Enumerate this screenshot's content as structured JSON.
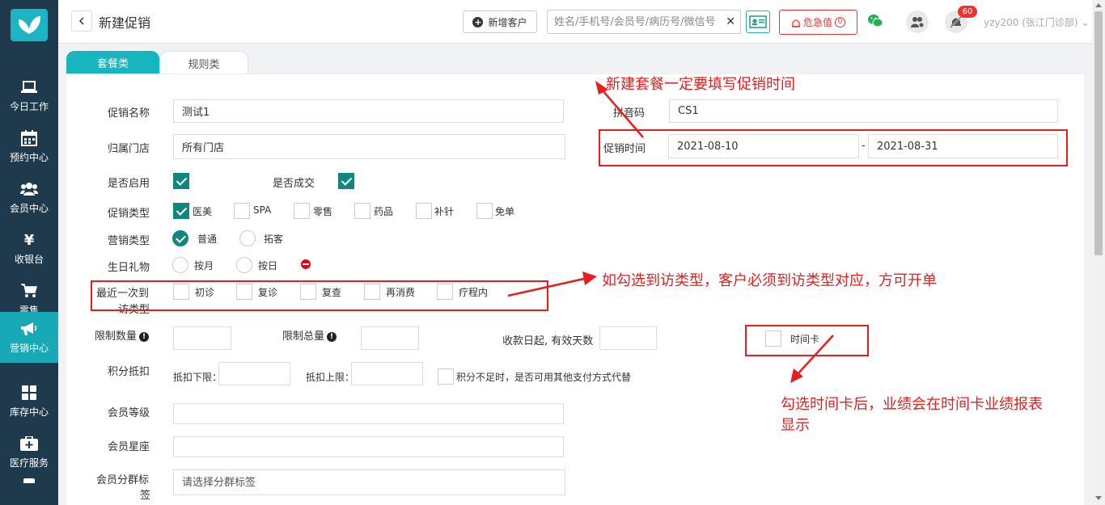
{
  "sidebar": {
    "items": [
      {
        "label": "今日工作",
        "icon": "laptop-icon"
      },
      {
        "label": "预约中心",
        "icon": "calendar-icon"
      },
      {
        "label": "会员中心",
        "icon": "users-icon"
      },
      {
        "label": "收银台",
        "icon": "yen-icon"
      },
      {
        "label": "零售",
        "icon": "cart-icon"
      },
      {
        "label": "营销中心",
        "icon": "megaphone-icon",
        "active": true
      },
      {
        "label": "库存中心",
        "icon": "grid-icon"
      },
      {
        "label": "医疗服务",
        "icon": "medical-kit-icon"
      }
    ]
  },
  "header": {
    "title": "新建促销",
    "add_customer_label": "新增客户",
    "search_placeholder": "姓名/手机号/会员号/病历号/微信号",
    "search_clear": "✕",
    "danger_label": "危急值",
    "danger_count": "0",
    "notification_count": "60",
    "user": "yzy200 (张江门诊部) ⌄"
  },
  "tabs": [
    {
      "label": "套餐类",
      "active": true
    },
    {
      "label": "规则类",
      "active": false
    }
  ],
  "form": {
    "name_label": "促销名称",
    "name_value": "测试1",
    "pinyin_label": "拼音码",
    "pinyin_value": "CS1",
    "store_label": "归属门店",
    "store_value": "所有门店",
    "time_label": "促销时间",
    "time_start": "2021-08-10",
    "time_sep": "-",
    "time_end": "2021-08-31",
    "enabled_label": "是否启用",
    "deal_label": "是否成交",
    "promo_type_label": "促销类型",
    "promo_types": [
      {
        "label": "医美",
        "checked": true
      },
      {
        "label": "SPA",
        "checked": false
      },
      {
        "label": "零售",
        "checked": false
      },
      {
        "label": "药品",
        "checked": false
      },
      {
        "label": "补针",
        "checked": false
      },
      {
        "label": "免单",
        "checked": false
      }
    ],
    "marketing_type_label": "营销类型",
    "marketing_types": [
      {
        "label": "普通",
        "checked": true
      },
      {
        "label": "拓客",
        "checked": false
      }
    ],
    "birthday_label": "生日礼物",
    "birthday_options": [
      {
        "label": "按月",
        "checked": false
      },
      {
        "label": "按日",
        "checked": false
      }
    ],
    "last_visit_label_1": "最近一次到",
    "last_visit_label_2": "访类型",
    "visit_types": [
      {
        "label": "初诊",
        "checked": false
      },
      {
        "label": "复诊",
        "checked": false
      },
      {
        "label": "复查",
        "checked": false
      },
      {
        "label": "再消费",
        "checked": false
      },
      {
        "label": "疗程内",
        "checked": false
      }
    ],
    "limit_qty_label": "限制数量",
    "limit_total_label": "限制总量",
    "valid_days_label": "收款日起, 有效天数",
    "time_card_label": "时间卡",
    "points_label": "积分抵扣",
    "points_lower_label": "抵扣下限：",
    "points_upper_label": "抵扣上限：",
    "points_alt_label": "积分不足时，是否可用其他支付方式代替",
    "member_level_label": "会员等级",
    "member_star_label": "会员星座",
    "member_group_label_1": "会员分群标",
    "member_group_label_2": "签",
    "member_group_placeholder": "请选择分群标签"
  },
  "annotations": {
    "time_note": "新建套餐一定要填写促销时间",
    "visit_note": "如勾选到访类型，客户必须到访类型对应，方可开单",
    "card_note_1": "勾选时间卡后，业绩会在时间卡业绩报表",
    "card_note_2": "显示"
  },
  "colors": {
    "sidebar_bg": "#1f3a4d",
    "accent": "#17b5c0",
    "check_green": "#11867e",
    "annotation_red": "#e61e1e"
  }
}
